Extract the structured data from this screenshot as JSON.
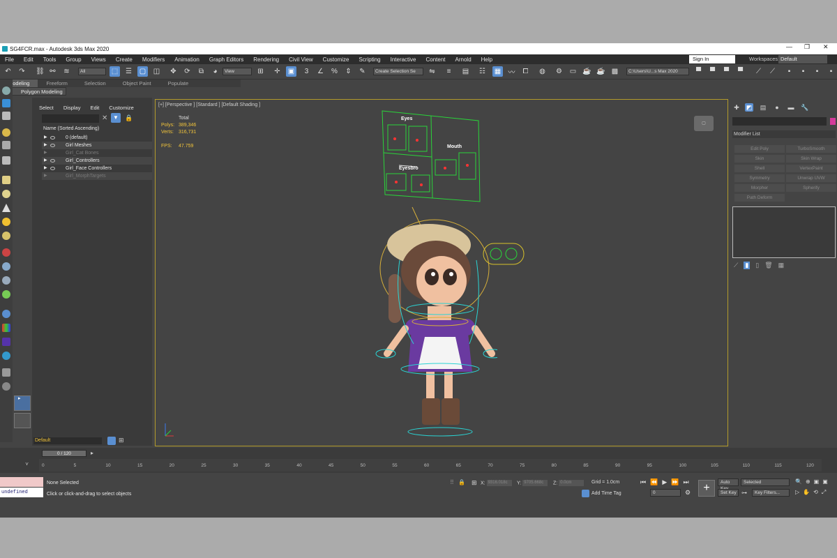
{
  "window": {
    "title": "SG4FCR.max - Autodesk 3ds Max 2020"
  },
  "menu": [
    "File",
    "Edit",
    "Tools",
    "Group",
    "Views",
    "Create",
    "Modifiers",
    "Animation",
    "Graph Editors",
    "Rendering",
    "Civil View",
    "Customize",
    "Scripting",
    "Interactive",
    "Content",
    "Arnold",
    "Help"
  ],
  "signin": {
    "label": "Sign In"
  },
  "workspace": {
    "label": "Workspaces:",
    "value": "Default"
  },
  "toolbar": {
    "filter": "All",
    "refcoord": "View",
    "selset": "Create Selection Se",
    "path": "C:\\Users\\U...s Max 2020"
  },
  "ribbon": {
    "tabs": [
      "Modeling",
      "Freeform",
      "Selection",
      "Object Paint",
      "Populate"
    ],
    "panel": "Polygon Modeling"
  },
  "scene": {
    "menu": [
      "Select",
      "Display",
      "Edit",
      "Customize"
    ],
    "header": "Name (Sorted Ascending)",
    "rows": [
      "0 (default)",
      "Girl Meshes",
      "Girl_Cat Bones",
      "Girl_Controllers",
      "Girl_Face Controllers",
      "Girl_MorphTargets"
    ],
    "footer": "Default"
  },
  "viewport": {
    "label": "[+] [Perspective ] [Standard ] [Default Shading ]",
    "stats": {
      "total": "Total",
      "polys_label": "Polys:",
      "polys": "389,346",
      "verts_label": "Verts:",
      "verts": "316,731",
      "fps_label": "FPS:",
      "fps": "47.759"
    },
    "face_panel": {
      "eyes": "Eyes",
      "mouth": "Mouth",
      "eyebrow": "Eyesbro"
    }
  },
  "cmdpanel": {
    "modifier_list": "Modifier List",
    "buttons": [
      "Edit Poly",
      "TurboSmooth",
      "Skin",
      "Skin Wrap",
      "Shell",
      "VertexPaint",
      "Symmetry",
      "Unwrap UVW",
      "Morpher",
      "Spherify",
      "Path Deform"
    ]
  },
  "timeline": {
    "slider": "0 / 120",
    "ticks": [
      "0",
      "5",
      "10",
      "15",
      "20",
      "25",
      "30",
      "35",
      "40",
      "45",
      "50",
      "55",
      "60",
      "65",
      "70",
      "75",
      "80",
      "85",
      "90",
      "95",
      "100",
      "105",
      "110",
      "115",
      "120"
    ]
  },
  "status": {
    "maxscript": "undefined",
    "selection": "None Selected",
    "prompt": "Click or click-and-drag to select objects",
    "x_label": "X:",
    "x": "9316.018c",
    "y_label": "Y:",
    "y": "9705.668c",
    "z_label": "Z:",
    "z": "0.0cm",
    "grid": "Grid = 1.0cm",
    "add_time_tag": "Add Time Tag",
    "frame": "0",
    "auto_key": "Auto Key",
    "set_key": "Set Key",
    "key_mode": "Selected",
    "key_filters": "Key Filters..."
  }
}
